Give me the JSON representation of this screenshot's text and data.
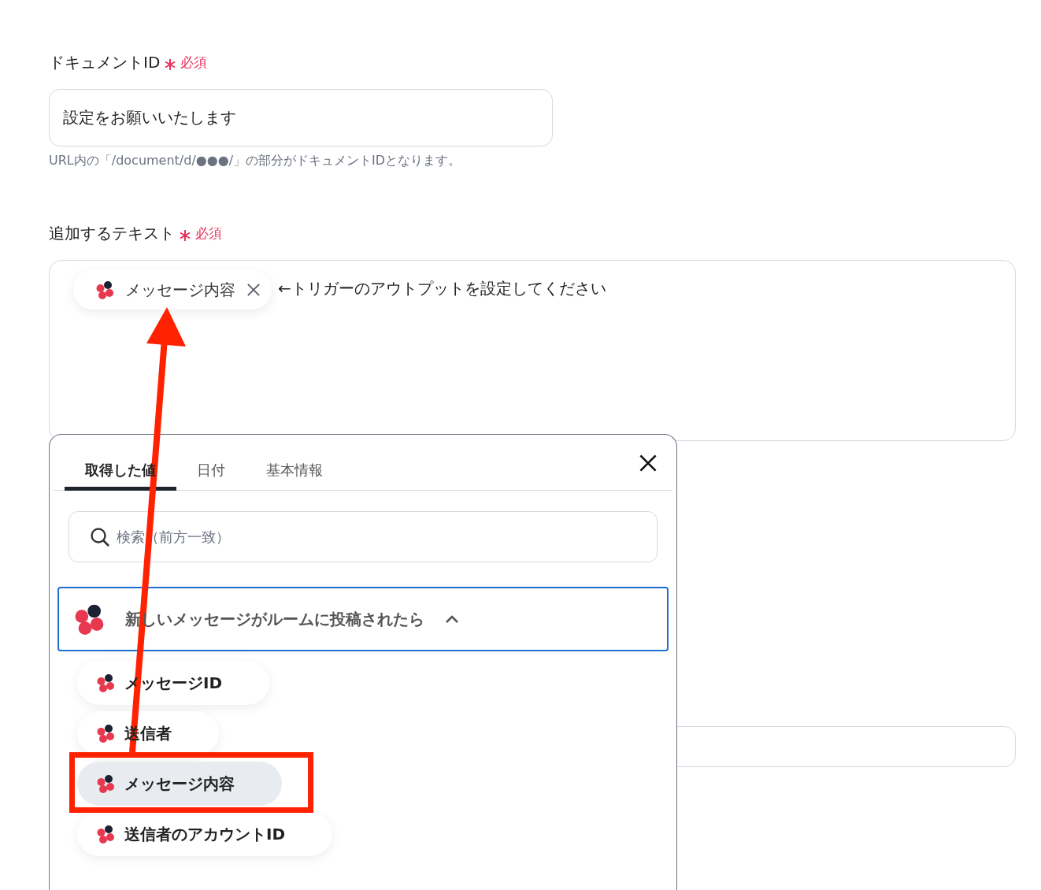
{
  "fields": [
    {
      "kind": "input",
      "label": "ドキュメントID",
      "required": "必須",
      "value": "設定をお願いいたします",
      "hint": "URL内の「/document/d/●●●/」の部分がドキュメントIDとなります。"
    },
    {
      "kind": "textarea",
      "label": "追加するテキスト",
      "required": "必須",
      "chips": [
        {
          "label": "メッセージ内容"
        }
      ],
      "text": "←トリガーのアウトプットを設定してください"
    },
    {
      "kind": "blank_input"
    }
  ],
  "picker": {
    "tabs": [
      {
        "label": "取得した値",
        "selected": true
      },
      {
        "label": "日付",
        "selected": false
      },
      {
        "label": "基本情報",
        "selected": false
      }
    ],
    "search": {
      "placeholder": "検索（前方一致）"
    },
    "groups": [
      {
        "title": "新しいメッセージがルームに投稿されたら",
        "expanded": true,
        "items": [
          {
            "label": "メッセージID",
            "selected": false
          },
          {
            "label": "送信者",
            "selected": false
          },
          {
            "label": "メッセージ内容",
            "selected": true
          },
          {
            "label": "送信者のアカウントID",
            "selected": false
          }
        ]
      }
    ]
  }
}
